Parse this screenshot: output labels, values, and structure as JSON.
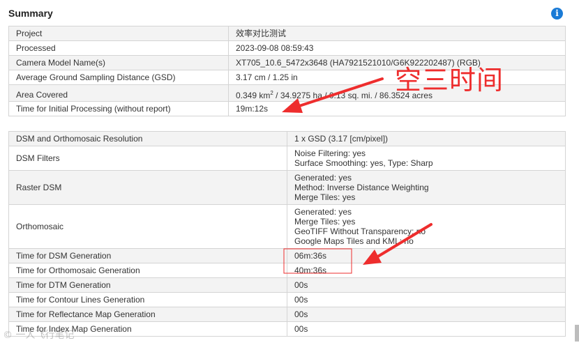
{
  "header": {
    "title": "Summary",
    "info_icon": "info-icon"
  },
  "summary": [
    {
      "label": "Project",
      "value": "效率对比测试"
    },
    {
      "label": "Processed",
      "value": "2023-09-08 08:59:43"
    },
    {
      "label": "Camera Model Name(s)",
      "value": "XT705_10.6_5472x3648 (HA7921521010/G6K922202487) (RGB)"
    },
    {
      "label": "Average Ground Sampling Distance (GSD)",
      "value": "3.17 cm / 1.25 in"
    },
    {
      "label": "Area Covered",
      "value_pre": "0.349 km",
      "value_sup": "2",
      "value_post": " / 34.9275 ha / 0.13 sq. mi. / 86.3524 acres"
    },
    {
      "label": "Time for Initial Processing (without report)",
      "value": "19m:12s"
    }
  ],
  "dsm": [
    {
      "label": "DSM and Orthomosaic Resolution",
      "lines": [
        "1 x GSD (3.17 [cm/pixel])"
      ]
    },
    {
      "label": "DSM Filters",
      "lines": [
        "Noise Filtering: yes",
        "Surface Smoothing: yes, Type: Sharp"
      ]
    },
    {
      "label": "Raster DSM",
      "lines": [
        "Generated: yes",
        "Method: Inverse Distance Weighting",
        "Merge Tiles: yes"
      ]
    },
    {
      "label": "Orthomosaic",
      "lines": [
        "Generated: yes",
        "Merge Tiles: yes",
        "GeoTIFF Without Transparency: no",
        "Google Maps Tiles and KML: no"
      ]
    },
    {
      "label": "Time for DSM Generation",
      "lines": [
        "06m:36s"
      ]
    },
    {
      "label": "Time for Orthomosaic Generation",
      "lines": [
        "40m:36s"
      ]
    },
    {
      "label": "Time for DTM Generation",
      "lines": [
        "00s"
      ]
    },
    {
      "label": "Time for Contour Lines Generation",
      "lines": [
        "00s"
      ]
    },
    {
      "label": "Time for Reflectance Map Generation",
      "lines": [
        "00s"
      ]
    },
    {
      "label": "Time for Index Map Generation",
      "lines": [
        "00s"
      ]
    }
  ],
  "annotation": {
    "text": "空三时间",
    "color": "#ee2d2d"
  },
  "watermark": {
    "text": "© 一人飞行笔记"
  }
}
